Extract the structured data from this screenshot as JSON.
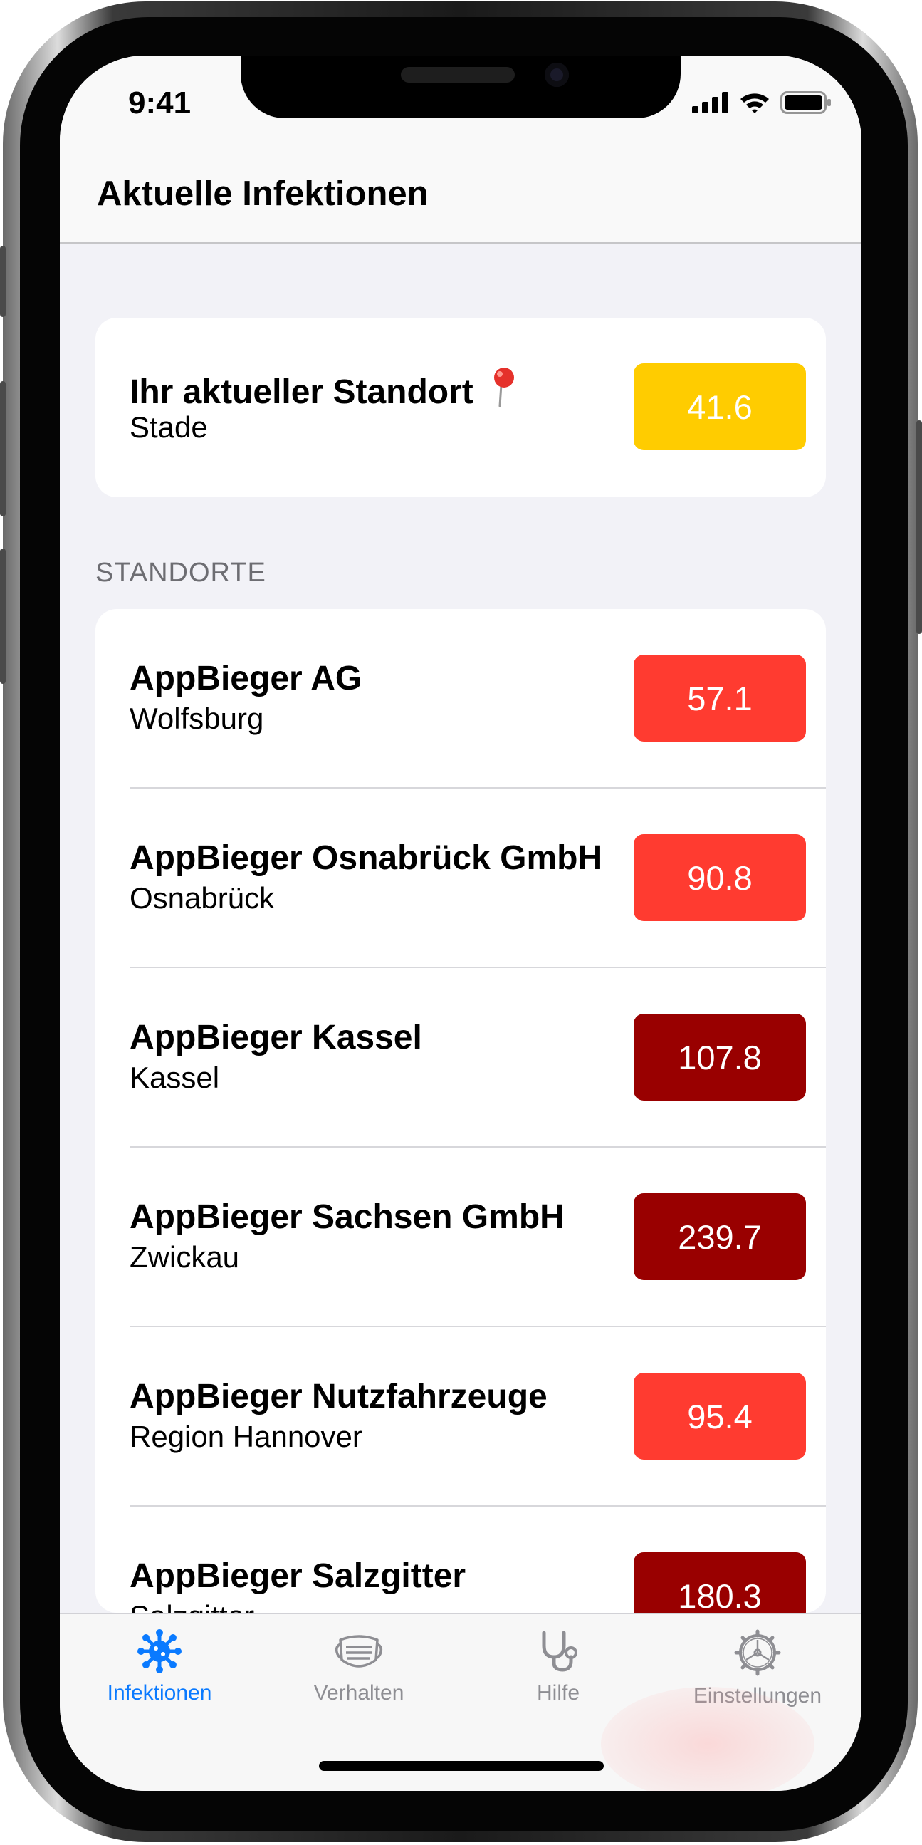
{
  "status_bar": {
    "time": "9:41"
  },
  "nav": {
    "title": "Aktuelle Infektionen"
  },
  "current_location": {
    "title": "Ihr aktueller Standort",
    "icon": "pin-icon",
    "city": "Stade",
    "value": "41.6",
    "color": "#FFCC00"
  },
  "section_header": "STANDORTE",
  "locations": [
    {
      "name": "AppBieger AG",
      "city": "Wolfsburg",
      "value": "57.1",
      "color": "#FF3B30"
    },
    {
      "name": "AppBieger Osnabrück GmbH",
      "city": "Osnabrück",
      "value": "90.8",
      "color": "#FF3B30"
    },
    {
      "name": "AppBieger Kassel",
      "city": "Kassel",
      "value": "107.8",
      "color": "#990000"
    },
    {
      "name": "AppBieger Sachsen GmbH",
      "city": "Zwickau",
      "value": "239.7",
      "color": "#990000"
    },
    {
      "name": "AppBieger Nutzfahrzeuge",
      "city": "Region Hannover",
      "value": "95.4",
      "color": "#FF3B30"
    },
    {
      "name": "AppBieger Salzgitter",
      "city": "Salzgitter",
      "value": "180.3",
      "color": "#990000"
    }
  ],
  "tabs": [
    {
      "label": "Infektionen",
      "icon": "virus-icon",
      "active": true
    },
    {
      "label": "Verhalten",
      "icon": "mask-icon",
      "active": false
    },
    {
      "label": "Hilfe",
      "icon": "stethoscope-icon",
      "active": false
    },
    {
      "label": "Einstellungen",
      "icon": "gear-icon",
      "active": false
    }
  ],
  "colors": {
    "accent": "#0A7AFF",
    "inactive": "#8E8E93"
  }
}
